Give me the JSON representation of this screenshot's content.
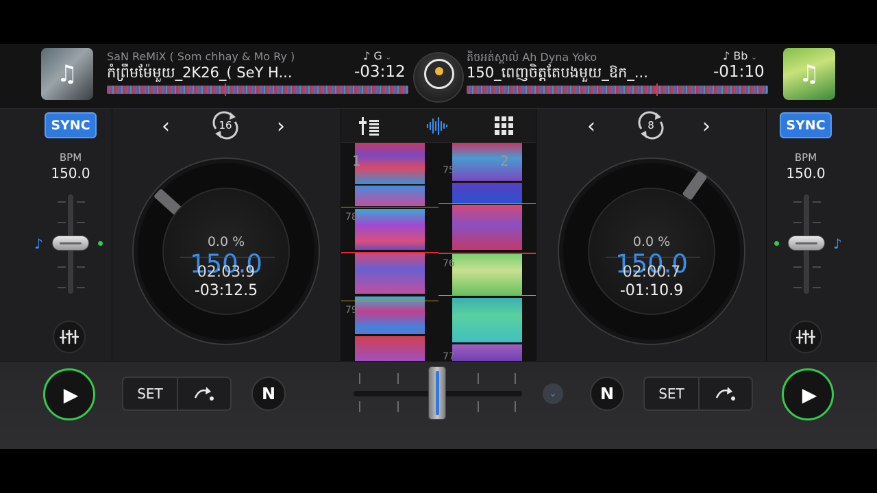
{
  "deck_a": {
    "artist": "SaN ReMiX ( Som chhay & Mo Ry )",
    "title": "កំព្រឹមម៉ែមួយ_2K26_( SeY H...",
    "key": "G",
    "time_remaining_header": "-03:12",
    "sync_label": "SYNC",
    "bpm_label": "BPM",
    "bpm": "150.0",
    "loop_length": "16",
    "pitch_percent": "0.0 %",
    "jog_bpm": "150.0",
    "elapsed": "02:03.9",
    "remaining": "-03:12.5",
    "set_label": "SET",
    "n_label": "N"
  },
  "deck_b": {
    "artist": "តិចអត់ស្គាល់ Ah Dyna Yoko",
    "title": "150_ពេញចិត្តតែបងមួយ_ឱក_...",
    "key": "Bb",
    "time_remaining_header": "-01:10",
    "sync_label": "SYNC",
    "bpm_label": "BPM",
    "bpm": "150.0",
    "loop_length": "8",
    "pitch_percent": "0.0 %",
    "jog_bpm": "150.0",
    "elapsed": "02:00.7",
    "remaining": "-01:10.9",
    "set_label": "SET",
    "n_label": "N"
  },
  "waveform": {
    "left_deck_number": "1",
    "right_deck_number": "2",
    "left_beat_numbers": [
      "78",
      "79"
    ],
    "right_beat_numbers": [
      "75",
      "76",
      "77"
    ]
  },
  "icons": {
    "note": "♪",
    "music_note_art": "♫",
    "prev": "‹",
    "next": "›",
    "play": "▶",
    "chevron_down": "⌄"
  },
  "colors": {
    "accent_blue": "#3a8eea",
    "sync_blue": "#2f7ae0",
    "play_green": "#36c94e",
    "marker_red": "#e02a3a"
  }
}
